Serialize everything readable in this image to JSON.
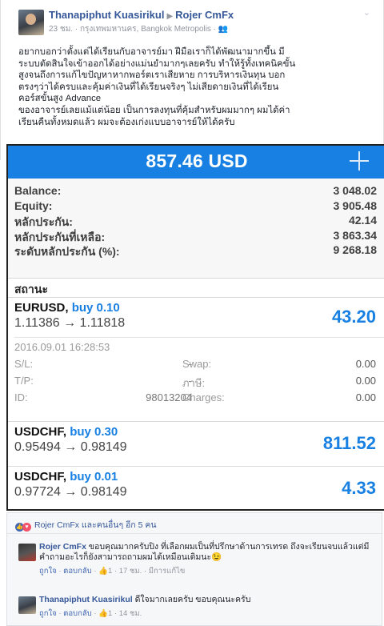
{
  "post": {
    "author": "Thanapiphut Kuasirikul",
    "page": "Rojer CmFx",
    "meta": "23 ชม. · กรุงเทพมหานคร, Bangkok Metropolis · ",
    "text_lines": [
      "อยากบอกว่าตั้งแต่ได้เรียนกับอาจารย์มา ฝีมือเราก็ได้พัฒนามากขึ้น มี",
      "ระบบตัดสินใจเข้าออกได้อย่างแม่นยำมากๆเลยครับ ทำให้รู้ทั้งเทคนิคขั้น",
      "สูงจนถึงการแก้ไขปัญหาหากพอร์ตเราเสียหาย การบริหารเงินทุน บอก",
      "ตรงๆว่าได้ครบและคุ้มค่าเงินที่ได้เรียนจริงๆ ไม่เสียดายเงินที่ได้เรียน",
      "คอร์สขั้นสูง Advance",
      "ของอาจารย์เลยแม้แต่น้อย เป็นการลงทุนที่คุ้มสำหรับผมมากๆ ผมได้ค่า",
      "เรียนคืนทั้งหมดแล้ว ผมจะต้องเก่งแบบอาจารย์ให้ได้ครับ"
    ]
  },
  "mt4": {
    "title": "857.46 USD",
    "summary": [
      {
        "label": "Balance:",
        "value": "3 048.02"
      },
      {
        "label": "Equity:",
        "value": "3 905.48"
      },
      {
        "label": "หลักประกัน:",
        "value": "42.14"
      },
      {
        "label": "หลักประกันที่เหลือ:",
        "value": "3 863.34"
      },
      {
        "label": "ระดับหลักประกัน (%):",
        "value": "9 268.18"
      }
    ],
    "status_heading": "สถานะ",
    "orders": [
      {
        "symbol": "EURUSD,",
        "side": "buy 0.10",
        "prices": "1.11386 → 1.11818",
        "profit": "43.20",
        "time": "2016.09.01 16:28:53",
        "details": {
          "sl_label": "S/L:",
          "sl_value": "-",
          "swap_label": "Swap:",
          "swap_value": "0.00",
          "tp_label": "T/P:",
          "tp_value": "-",
          "tax_label": "ภาษี:",
          "tax_value": "0.00",
          "id_label": "ID:",
          "id_value": "98013204",
          "charges_label": "Charges:",
          "charges_value": "0.00"
        }
      },
      {
        "symbol": "USDCHF,",
        "side": "buy 0.30",
        "prices": "0.95494 → 0.98149",
        "profit": "811.52"
      },
      {
        "symbol": "USDCHF,",
        "side": "buy 0.01",
        "prices": "0.97724 → 0.98149",
        "profit": "4.33"
      }
    ]
  },
  "comments": {
    "reactions_text": "Rojer CmFx และคนอื่นๆ อีก 5 คน",
    "items": [
      {
        "author": "Rojer CmFx",
        "text": " ขอบคุณมากครับปิง ที่เลือกผมเป็นที่ปรึกษาด้านการเทรด ถึงจะเรียนจบแล้วแต่มีคำถามอะไรก็ยังสามารถถามผมได้เหมือนเดิมนะ😉",
        "like": "ถูกใจ",
        "reply": "ตอบกลับ",
        "count": "1",
        "time": "17 ชม.",
        "edited": "มีการแก้ไข"
      },
      {
        "author": "Thanapiphut Kuasirikul",
        "text": " ดีใจมากเลยครับ ขอบคุณนะครับ",
        "like": "ถูกใจ",
        "reply": "ตอบกลับ",
        "count": "1",
        "time": "14 ชม."
      }
    ]
  }
}
